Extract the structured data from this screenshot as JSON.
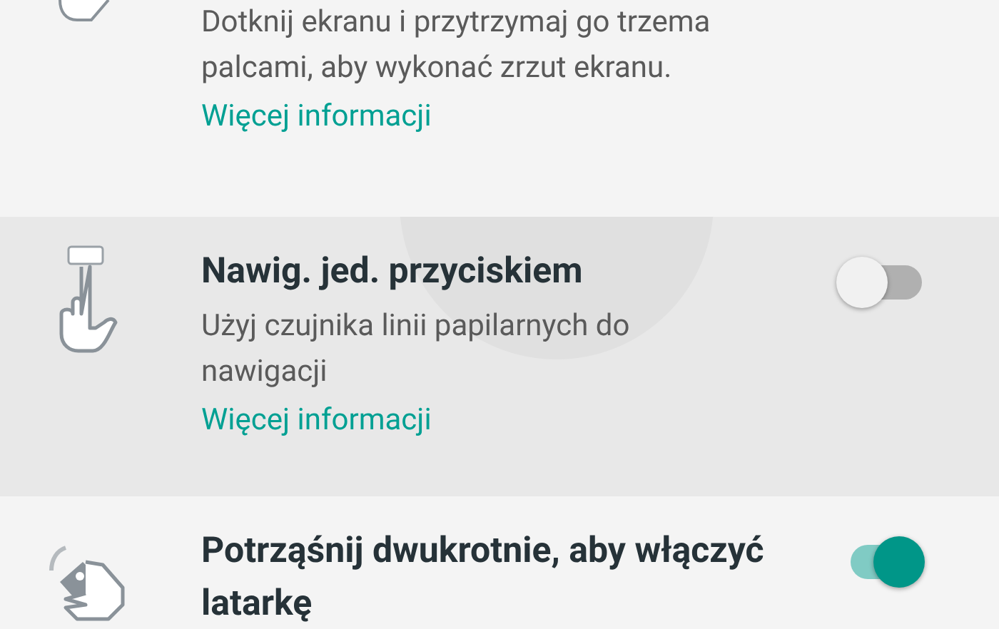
{
  "settings": [
    {
      "kind": "two_finger",
      "description": "Dotknij ekranu i przytrzymaj go trzema palcami, aby wykonać zrzut ekranu.",
      "link": "Więcej informacji"
    },
    {
      "kind": "one_finger",
      "title": "Nawig. jed. przyciskiem",
      "description": "Użyj czujnika linii papilarnych do nawigacji",
      "link": "Więcej informacji",
      "highlighted": true,
      "on": false
    },
    {
      "kind": "shake",
      "title": "Potrząśnij dwukrotnie, aby włączyć latarkę",
      "highlighted": false,
      "on": true
    }
  ]
}
